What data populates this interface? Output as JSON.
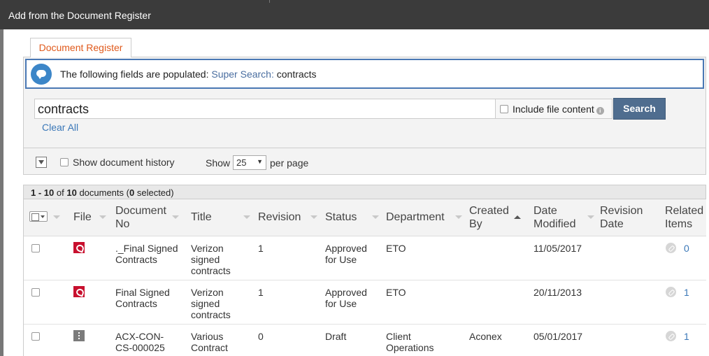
{
  "window": {
    "title": "Add from the Document Register"
  },
  "tabs": [
    {
      "label": "Document Register",
      "active": true
    }
  ],
  "info": {
    "prefix": "The following fields are populated:",
    "field_name": "Super Search:",
    "field_value": "contracts"
  },
  "search": {
    "value": "contracts",
    "include_file_content_label": "Include file content",
    "include_file_content_checked": false,
    "button_label": "Search",
    "clear_all_label": "Clear All"
  },
  "options": {
    "show_history_label": "Show document history",
    "show_history_checked": false,
    "show_label": "Show",
    "per_page_value": "25",
    "per_page_label": "per page"
  },
  "summary": {
    "range": "1 - 10",
    "of_label": "of",
    "total": "10",
    "documents_label": "documents",
    "selected": "0",
    "selected_label": "selected"
  },
  "table": {
    "columns": {
      "file": "File",
      "document_no": [
        "Document",
        "No"
      ],
      "title": "Title",
      "revision": "Revision",
      "status": "Status",
      "department": "Department",
      "created_by": [
        "Created",
        "By"
      ],
      "date_modified": [
        "Date",
        "Modified"
      ],
      "revision_date": [
        "Revision",
        "Date"
      ],
      "related_items": [
        "Related",
        "Items"
      ]
    },
    "rows": [
      {
        "file_type": "pdf-icon",
        "document_no": [
          "._Final Signed",
          "Contracts"
        ],
        "title": [
          "Verizon",
          "signed",
          "contracts"
        ],
        "revision": "1",
        "status": [
          "Approved",
          "for Use"
        ],
        "department": [
          "ETO",
          ""
        ],
        "created_by": "",
        "date_modified": "11/05/2017",
        "revision_date": "",
        "related_items": "0"
      },
      {
        "file_type": "pdf-icon",
        "document_no": [
          "Final Signed",
          "Contracts"
        ],
        "title": [
          "Verizon",
          "signed",
          "contracts"
        ],
        "revision": "1",
        "status": [
          "Approved",
          "for Use"
        ],
        "department": [
          "ETO",
          ""
        ],
        "created_by": "",
        "date_modified": "20/11/2013",
        "revision_date": "",
        "related_items": "1"
      },
      {
        "file_type": "zip-icon",
        "document_no": [
          "ACX-CON-",
          "CS-000025"
        ],
        "title": [
          "Various",
          "Contract",
          ""
        ],
        "revision": "0",
        "status": [
          "Draft",
          ""
        ],
        "department": [
          "Client",
          "Operations"
        ],
        "created_by": "Aconex",
        "date_modified": "05/01/2017",
        "revision_date": "",
        "related_items": "1"
      }
    ]
  },
  "colors": {
    "titlebar": "#3b3b3b",
    "tab_text": "#e05a1c",
    "info_border": "#4a78b4",
    "search_button": "#4f6d8f",
    "link": "#3b78b8",
    "pdf": "#c8102e"
  }
}
